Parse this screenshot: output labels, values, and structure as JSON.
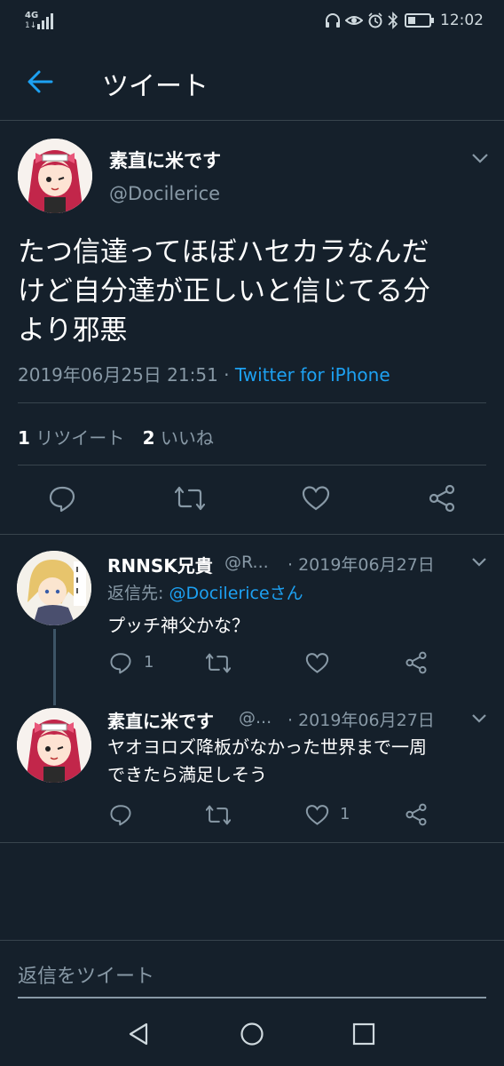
{
  "status_bar": {
    "network": "4G",
    "network_sub": "1↓",
    "time": "12:02"
  },
  "header": {
    "title": "ツイート"
  },
  "main_tweet": {
    "display_name": "素直に米です",
    "handle": "@Docilerice",
    "text_lines": [
      "たつ信達ってほぼハセカラなんだ",
      "けど自分達が正しいと信じてる分",
      "より邪悪"
    ],
    "timestamp": "2019年06月25日 21:51",
    "separator": " · ",
    "source": "Twitter for iPhone",
    "retweet_count": "1",
    "retweet_label": "リツイート",
    "like_count": "2",
    "like_label": "いいね"
  },
  "replies": [
    {
      "display_name": "RNNSK兄貴",
      "handle": "@R...",
      "date": "· 2019年06月27日",
      "reply_to_label": "返信先:",
      "reply_to_handle": "@Docilericeさん",
      "text_lines": [
        "プッチ神父かな？"
      ],
      "reply_count": "1",
      "like_count": ""
    },
    {
      "display_name": "素直に米です",
      "handle": "@...",
      "date": "· 2019年06月27日",
      "text_lines": [
        "ヤオヨロズ降板がなかった世界まで一周",
        "できたら満足しそう"
      ],
      "reply_count": "",
      "like_count": "1"
    }
  ],
  "composer": {
    "placeholder": "返信をツイート"
  },
  "colors": {
    "background": "#15202b",
    "accent": "#1da1f2",
    "muted": "#8899a6",
    "divider": "#38444d"
  }
}
